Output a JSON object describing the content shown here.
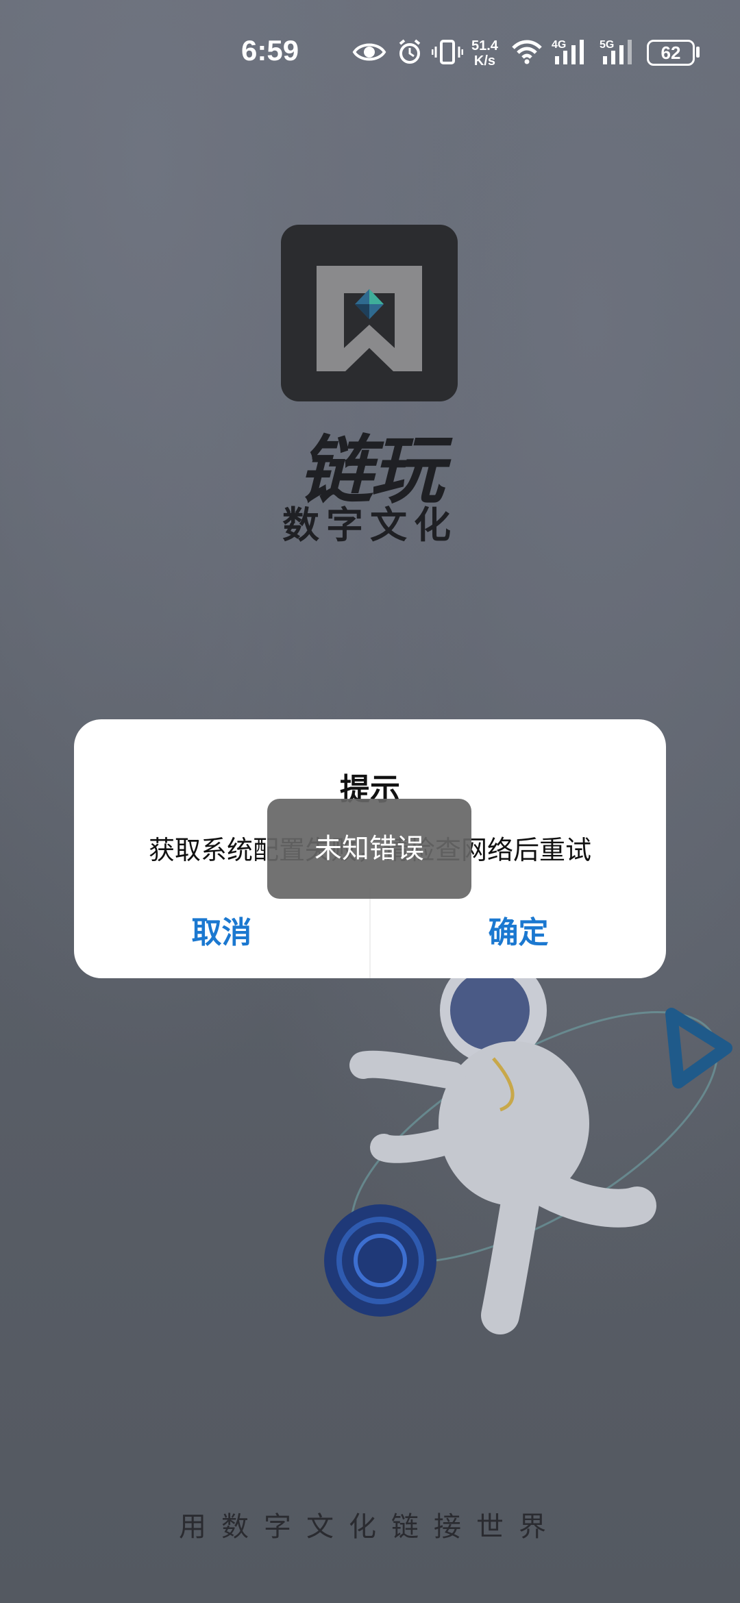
{
  "status_bar": {
    "time": "6:59",
    "net_speed_value": "51.4",
    "net_speed_unit": "K/s",
    "signal1_label": "4G",
    "signal2_label": "5G",
    "battery": "62"
  },
  "brand": {
    "name": "链玩",
    "subtitle": "数字文化"
  },
  "dialog": {
    "title": "提示",
    "message": "获取系统配置失败，请检查网络后重试",
    "cancel_label": "取消",
    "confirm_label": "确定"
  },
  "toast": {
    "text": "未知错误"
  },
  "slogan": "用数字文化链接世界",
  "colors": {
    "accent": "#1b78d0",
    "background": "#5f6470",
    "toast_bg": "#666666"
  }
}
